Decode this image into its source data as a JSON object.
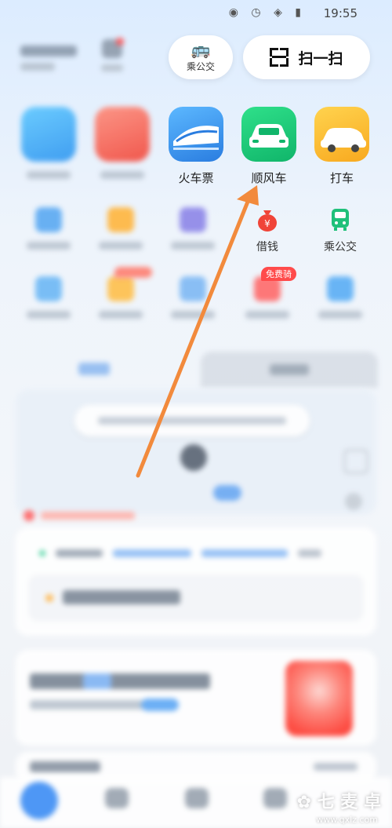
{
  "status_bar": {
    "time": "19:55"
  },
  "header": {
    "bus_label": "乘公交",
    "scan_label": "扫一扫"
  },
  "services": [
    {
      "label": ""
    },
    {
      "label": ""
    },
    {
      "label": "火车票"
    },
    {
      "label": "顺风车"
    },
    {
      "label": "打车"
    }
  ],
  "small_row1": [
    {
      "label": ""
    },
    {
      "label": ""
    },
    {
      "label": ""
    },
    {
      "label": "借钱"
    },
    {
      "label": "乘公交"
    }
  ],
  "small_row2": [
    {
      "label": "",
      "badge": ""
    },
    {
      "label": "",
      "badge": ""
    },
    {
      "label": "",
      "badge": ""
    },
    {
      "label": "",
      "badge": "免费骑"
    },
    {
      "label": "",
      "badge": ""
    }
  ],
  "watermark": {
    "url": "www.qxlz.com"
  },
  "colors": {
    "accent": "#3d8ef5",
    "arrow": "#f28a3c"
  }
}
